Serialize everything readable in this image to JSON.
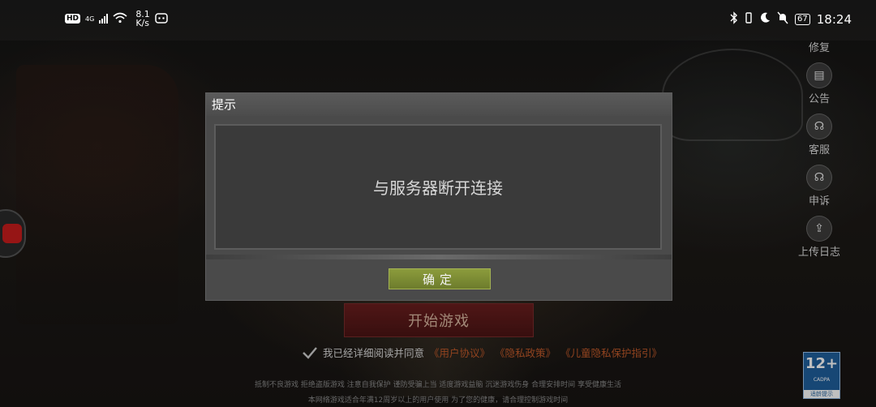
{
  "status_bar": {
    "hd": "HD",
    "net_type": "4G",
    "speed_value": "8.1",
    "speed_unit": "K/s",
    "battery": "67",
    "time": "18:24"
  },
  "sidebar": {
    "items": [
      {
        "label": "修复",
        "icon": "repair-icon"
      },
      {
        "label": "公告",
        "icon": "announcement-icon"
      },
      {
        "label": "客服",
        "icon": "customer-service-icon"
      },
      {
        "label": "申诉",
        "icon": "appeal-icon"
      },
      {
        "label": "上传日志",
        "icon": "upload-log-icon"
      }
    ]
  },
  "main": {
    "start_button": "开始游戏",
    "agree_text": "我已经详细阅读并同意",
    "links": [
      "《用户协议》",
      "《隐私政策》",
      "《儿童隐私保护指引》"
    ],
    "footer_line1": "抵制不良游戏 拒绝盗版游戏 注意自我保护 谨防受骗上当 适度游戏益脑 沉迷游戏伤身 合理安排时间 享受健康生活",
    "footer_line2": "本网络游戏适合年满12周岁以上的用户使用   为了您的健康，请合理控制游戏时间"
  },
  "age_badge": {
    "rating": "12+",
    "org": "CADPA",
    "tip": "适龄提示"
  },
  "dialog": {
    "title": "提示",
    "message": "与服务器断开连接",
    "confirm_label": "确定"
  },
  "colors": {
    "confirm_button": "#7c8c35",
    "link_red": "#c25a2a",
    "start_button": "#5a1a1a",
    "dialog_bg": "#4a4a4a"
  }
}
